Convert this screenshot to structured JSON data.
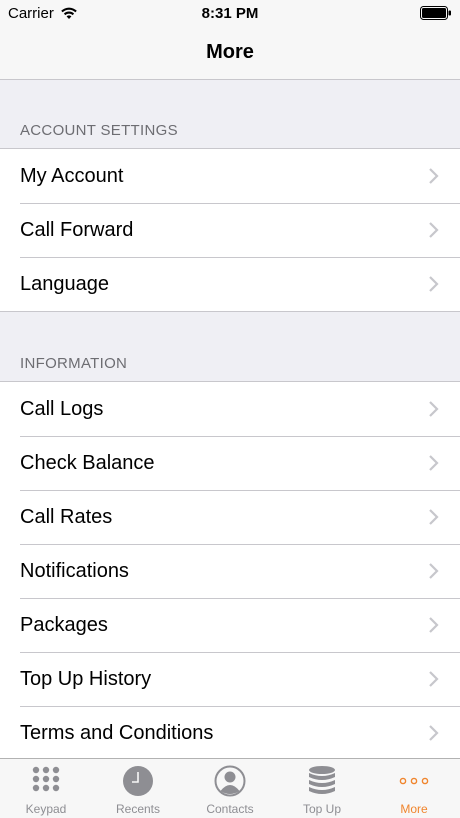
{
  "status_bar": {
    "carrier": "Carrier",
    "time": "8:31 PM"
  },
  "nav": {
    "title": "More"
  },
  "sections": [
    {
      "header": "ACCOUNT SETTINGS",
      "items": [
        {
          "label": "My Account"
        },
        {
          "label": "Call Forward"
        },
        {
          "label": "Language"
        }
      ]
    },
    {
      "header": "INFORMATION",
      "items": [
        {
          "label": "Call Logs"
        },
        {
          "label": "Check Balance"
        },
        {
          "label": "Call Rates"
        },
        {
          "label": "Notifications"
        },
        {
          "label": "Packages"
        },
        {
          "label": "Top Up History"
        },
        {
          "label": "Terms and Conditions"
        }
      ]
    }
  ],
  "tab_bar": {
    "active": "More",
    "tabs": [
      {
        "label": "Keypad",
        "icon": "keypad-icon"
      },
      {
        "label": "Recents",
        "icon": "clock-icon"
      },
      {
        "label": "Contacts",
        "icon": "contacts-icon"
      },
      {
        "label": "Top Up",
        "icon": "database-icon"
      },
      {
        "label": "More",
        "icon": "more-dots-icon"
      }
    ]
  },
  "colors": {
    "accent": "#f0852d",
    "tab_inactive": "#8e8e93",
    "background": "#efeff4",
    "separator": "#c8c7cc"
  }
}
